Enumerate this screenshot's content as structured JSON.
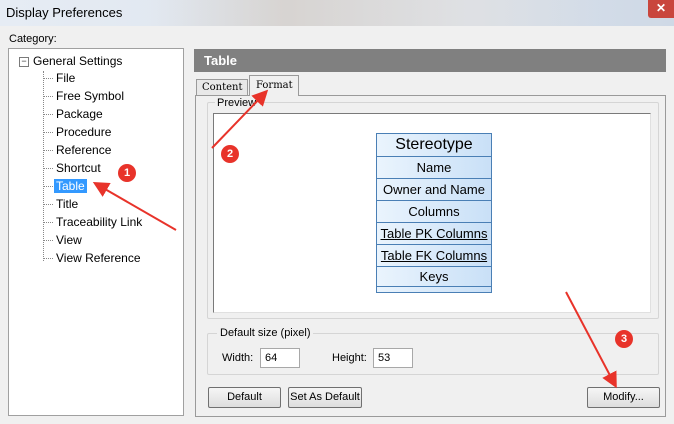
{
  "window": {
    "title": "Display Preferences"
  },
  "category": {
    "label": "Category:",
    "root": "General Settings",
    "items": [
      "File",
      "Free Symbol",
      "Package",
      "Procedure",
      "Reference",
      "Shortcut",
      "Table",
      "Title",
      "Traceability Link",
      "View",
      "View Reference"
    ],
    "selected": "Table"
  },
  "panel": {
    "title": "Table"
  },
  "tabs": {
    "content": "Content",
    "format": "Format",
    "active": "Format"
  },
  "preview": {
    "label": "Preview",
    "stereotype": "Stereotype",
    "rows": [
      "Name",
      "Owner and Name",
      "Columns",
      "Table PK Columns",
      "Table FK Columns",
      "Keys"
    ]
  },
  "default_size": {
    "label": "Default size (pixel)",
    "width_label": "Width:",
    "width_value": "64",
    "height_label": "Height:",
    "height_value": "53"
  },
  "buttons": {
    "default": "Default",
    "set_as_default": "Set As Default",
    "modify": "Modify..."
  },
  "annotations": {
    "badge1": "1",
    "badge2": "2",
    "badge3": "3",
    "color": "#e8332a"
  }
}
